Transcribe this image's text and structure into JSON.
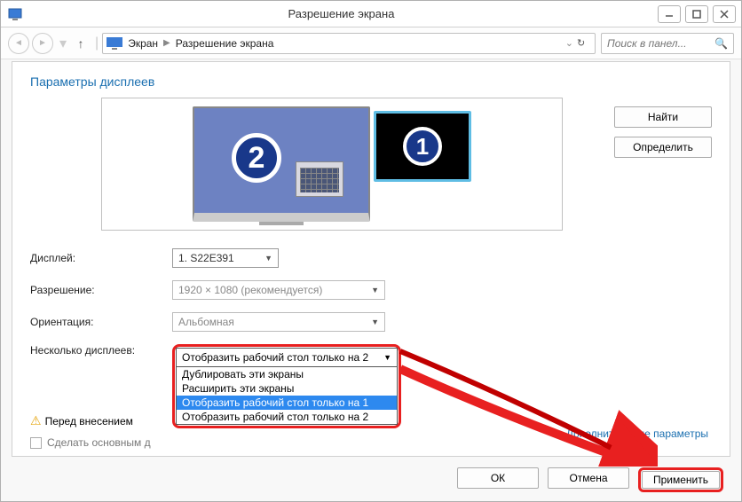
{
  "window": {
    "title": "Разрешение экрана"
  },
  "breadcrumb": {
    "root": "Экран",
    "current": "Разрешение экрана"
  },
  "search": {
    "placeholder": "Поиск в панел..."
  },
  "section_title": "Параметры дисплеев",
  "monitors": {
    "m1": "1",
    "m2": "2"
  },
  "side": {
    "find": "Найти",
    "identify": "Определить"
  },
  "labels": {
    "display": "Дисплей:",
    "resolution": "Разрешение:",
    "orientation": "Ориентация:",
    "multi": "Несколько дисплеев:",
    "warning_prefix": "Перед внесением",
    "make_primary": "Сделать основным д",
    "advanced": "Дополнительные параметры"
  },
  "values": {
    "display": "1. S22E391",
    "resolution": "1920 × 1080 (рекомендуется)",
    "orientation": "Альбомная",
    "multi_selected": "Отобразить рабочий стол только на 2"
  },
  "multi_options": [
    "Дублировать эти экраны",
    "Расширить эти экраны",
    "Отобразить рабочий стол только на 1",
    "Отобразить рабочий стол только на 2"
  ],
  "footer": {
    "ok": "ОК",
    "cancel": "Отмена",
    "apply": "Применить"
  }
}
